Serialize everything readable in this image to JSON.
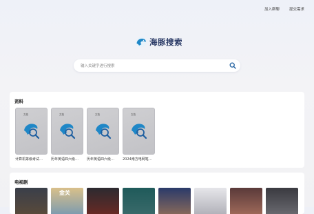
{
  "header": {
    "links": [
      "加入群聊",
      "提交需求"
    ]
  },
  "logo": {
    "text": "海豚搜索"
  },
  "search": {
    "placeholder": "输入关键字进行搜索"
  },
  "sections": {
    "docs": {
      "title": "资料",
      "items": [
        {
          "label": "计算机等级考试…",
          "badge": "文档"
        },
        {
          "label": "历年英语四六级…",
          "badge": "文档"
        },
        {
          "label": "历年英语四六级…",
          "badge": "文档"
        },
        {
          "label": "2024南方电网笔…",
          "badge": "文档"
        }
      ]
    },
    "tv": {
      "title": "电视剧",
      "items": [
        {
          "poster_icon": "tv-poster"
        },
        {
          "poster_icon": "tv-poster",
          "text": "金关"
        },
        {
          "poster_icon": "tv-poster"
        },
        {
          "poster_icon": "tv-poster"
        },
        {
          "poster_icon": "tv-poster"
        },
        {
          "poster_icon": "tv-poster"
        },
        {
          "poster_icon": "tv-poster"
        },
        {
          "poster_icon": "tv-poster"
        }
      ]
    }
  },
  "colors": {
    "accent": "#1f87c7",
    "brand_dark": "#2a3a66",
    "bg": "#eef0f7"
  }
}
